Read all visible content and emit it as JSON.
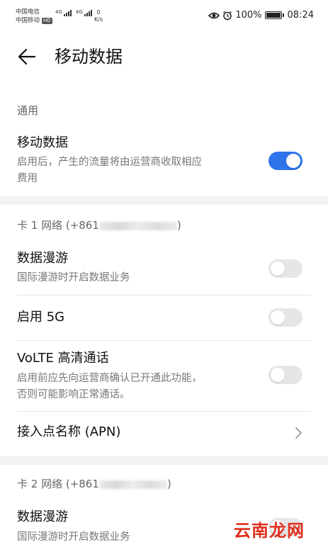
{
  "status_bar": {
    "carrier1": "中国电信",
    "carrier2": "中国移动",
    "hd_badge": "HD",
    "net_type1": "4G",
    "net_type2": "4G",
    "speed_value": "0",
    "speed_unit": "K/s",
    "battery": "100%",
    "time": "08:24",
    "icons": [
      "eye-comfort-icon",
      "alarm-icon",
      "battery-icon"
    ]
  },
  "header": {
    "title": "移动数据",
    "back_icon": "arrow-left-icon"
  },
  "general": {
    "section_label": "通用",
    "mobile_data": {
      "title": "移动数据",
      "desc_line1": "启用后，产生的流量将由运营商收取相应",
      "desc_line2": "费用",
      "enabled": true
    }
  },
  "sim1": {
    "section_label": "卡 1 网络 (+861",
    "section_label_end": ")",
    "roaming": {
      "title": "数据漫游",
      "desc": "国际漫游时开启数据业务",
      "enabled": false
    },
    "fiveg": {
      "title": "启用 5G",
      "enabled": false
    },
    "volte": {
      "title": "VoLTE 高清通话",
      "desc_line1": "启用前应先向运营商确认已开通此功能，",
      "desc_line2": "否则可能影响正常通话。",
      "enabled": false
    },
    "apn": {
      "title": "接入点名称 (APN)"
    }
  },
  "sim2": {
    "section_label": "卡 2 网络 (+861",
    "section_label_end": ")",
    "roaming": {
      "title": "数据漫游",
      "desc": "国际漫游时开启数据业务",
      "enabled": false
    }
  },
  "watermark": "云南龙网",
  "colors": {
    "accent": "#2f74ea",
    "toggle_off": "#e6e6e6",
    "section_gap": "#f1f3f5"
  }
}
